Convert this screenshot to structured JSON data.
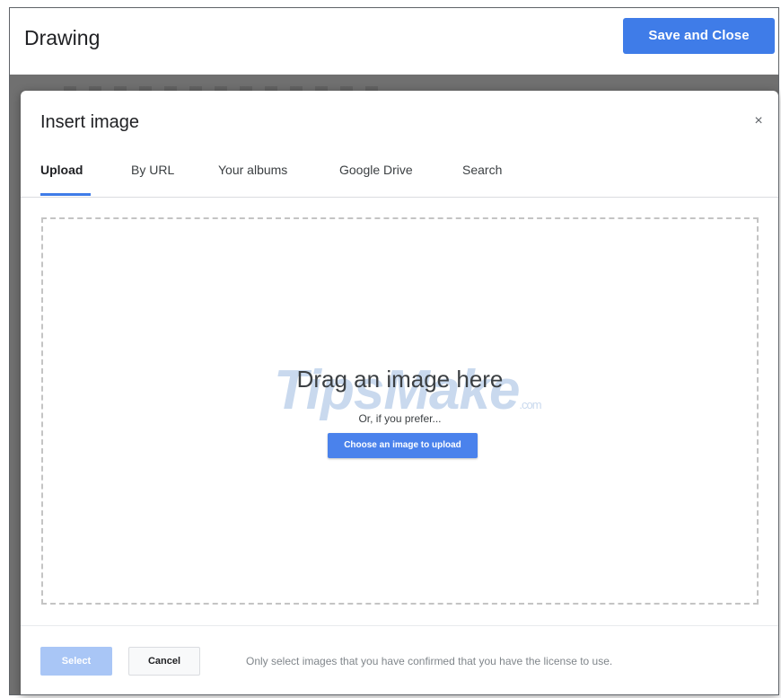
{
  "app": {
    "title": "Drawing",
    "save_close_label": "Save and Close"
  },
  "dialog": {
    "title": "Insert image",
    "close_icon": "close-icon",
    "close_glyph": "×",
    "tabs": [
      {
        "label": "Upload",
        "active": true
      },
      {
        "label": "By URL",
        "active": false
      },
      {
        "label": "Your albums",
        "active": false
      },
      {
        "label": "Google Drive",
        "active": false
      },
      {
        "label": "Search",
        "active": false
      }
    ],
    "drop_zone": {
      "heading": "Drag an image here",
      "or_text": "Or, if you prefer...",
      "choose_button": "Choose an image to upload"
    },
    "watermark": {
      "text": "TipsMake",
      "suffix": ".com"
    },
    "footer": {
      "select_label": "Select",
      "cancel_label": "Cancel",
      "note": "Only select images that you have confirmed that you have the license to use."
    }
  },
  "colors": {
    "accent": "#3f7ce8",
    "select_disabled": "#a9c6f6",
    "backdrop": "#707070"
  }
}
